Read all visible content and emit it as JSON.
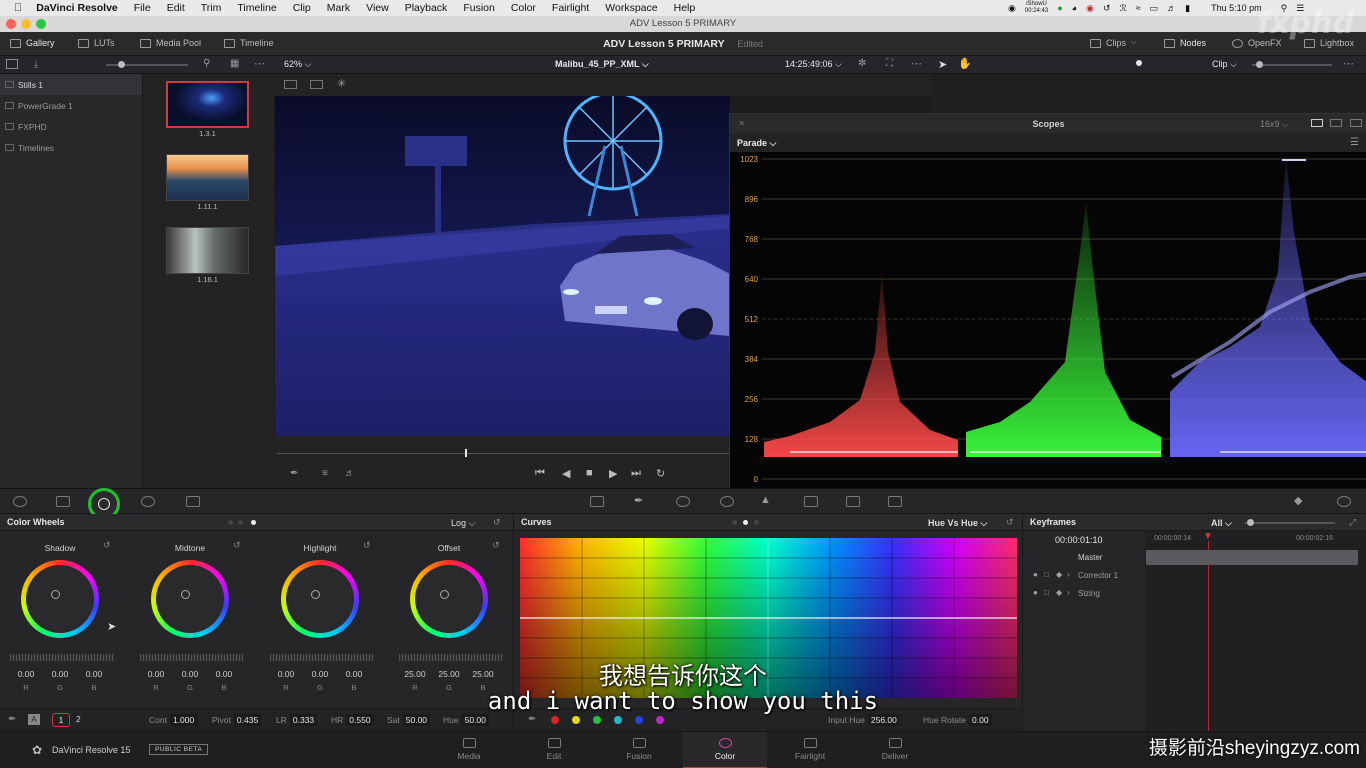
{
  "menubar": {
    "apple": "",
    "app": "DaVinci Resolve",
    "items": [
      "File",
      "Edit",
      "Trim",
      "Timeline",
      "Clip",
      "Mark",
      "View",
      "Playback",
      "Fusion",
      "Color",
      "Fairlight",
      "Workspace",
      "Help"
    ],
    "status_short": "iShowU",
    "status_time_small": "00:24:43",
    "clock": "Thu 5:10 pm"
  },
  "window": {
    "title": "ADV Lesson 5  PRIMARY"
  },
  "toolbar": {
    "gallery": "Gallery",
    "luts": "LUTs",
    "media_pool": "Media Pool",
    "timeline": "Timeline",
    "project": "ADV Lesson 5  PRIMARY",
    "edited": "Edited",
    "clips": "Clips",
    "nodes": "Nodes",
    "openfx": "OpenFX",
    "lightbox": "Lightbox"
  },
  "bar2": {
    "zoom": "62%",
    "clip_name": "Malibu_45_PP_XML",
    "timecode": "14:25:49:06",
    "mode": "Clip"
  },
  "gallery": {
    "albums": [
      {
        "label": "Stills 1",
        "selected": true
      },
      {
        "label": "PowerGrade 1",
        "selected": false
      },
      {
        "label": "FXPHD",
        "selected": false
      },
      {
        "label": "Timelines",
        "selected": false
      }
    ],
    "stills": [
      {
        "label": "1.3.1",
        "selected": true
      },
      {
        "label": "1.11.1",
        "selected": false
      },
      {
        "label": "1.16.1",
        "selected": false
      }
    ]
  },
  "scopes": {
    "title": "Scopes",
    "aspect": "16x9",
    "mode": "Parade",
    "scale": [
      "1023",
      "896",
      "768",
      "640",
      "512",
      "384",
      "256",
      "128",
      "0"
    ]
  },
  "color_wheels": {
    "title": "Color Wheels",
    "mode": "Log",
    "wheels": [
      {
        "label": "Shadow",
        "values": [
          "0.00",
          "0.00",
          "0.00"
        ]
      },
      {
        "label": "Midtone",
        "values": [
          "0.00",
          "0.00",
          "0.00"
        ]
      },
      {
        "label": "Highlight",
        "values": [
          "0.00",
          "0.00",
          "0.00"
        ]
      },
      {
        "label": "Offset",
        "values": [
          "25.00",
          "25.00",
          "25.00"
        ]
      }
    ],
    "channels": [
      "R",
      "G",
      "B"
    ],
    "page1": "1",
    "page2": "2",
    "footer": {
      "cont_label": "Cont",
      "cont": "1.000",
      "pivot_label": "Pivot",
      "pivot": "0.435",
      "lr_label": "LR",
      "lr": "0.333",
      "hr_label": "HR",
      "hr": "0.550",
      "sat_label": "Sat",
      "sat": "50.00",
      "hue_label": "Hue",
      "hue": "50.00"
    }
  },
  "curves": {
    "title": "Curves",
    "mode": "Hue Vs Hue",
    "input_hue_label": "Input Hue",
    "input_hue": "256.00",
    "hue_rotate_label": "Hue Rotate",
    "hue_rotate": "0.00"
  },
  "keyframes": {
    "title": "Keyframes",
    "filter": "All",
    "timecode": "00:00:01:10",
    "tc_start": "00:00:00:14",
    "tc_end": "00:00:02:16",
    "rows": [
      "Master",
      "Corrector 1",
      "Sizing"
    ]
  },
  "footer": {
    "app_version": "DaVinci Resolve 15",
    "badge": "PUBLIC BETA",
    "pages": [
      {
        "label": "Media",
        "active": false
      },
      {
        "label": "Edit",
        "active": false
      },
      {
        "label": "Fusion",
        "active": false
      },
      {
        "label": "Color",
        "active": true
      },
      {
        "label": "Fairlight",
        "active": false
      },
      {
        "label": "Deliver",
        "active": false
      }
    ]
  },
  "subtitles": {
    "zh": "我想告诉你这个",
    "en": "and i want to show you this"
  },
  "watermarks": {
    "top": "fxphd",
    "bottom": "摄影前沿sheyingzyz.com"
  },
  "colors": {
    "accent_red": "#d33c3c",
    "highlight_green": "#1fc12f",
    "panel": "#262629"
  }
}
